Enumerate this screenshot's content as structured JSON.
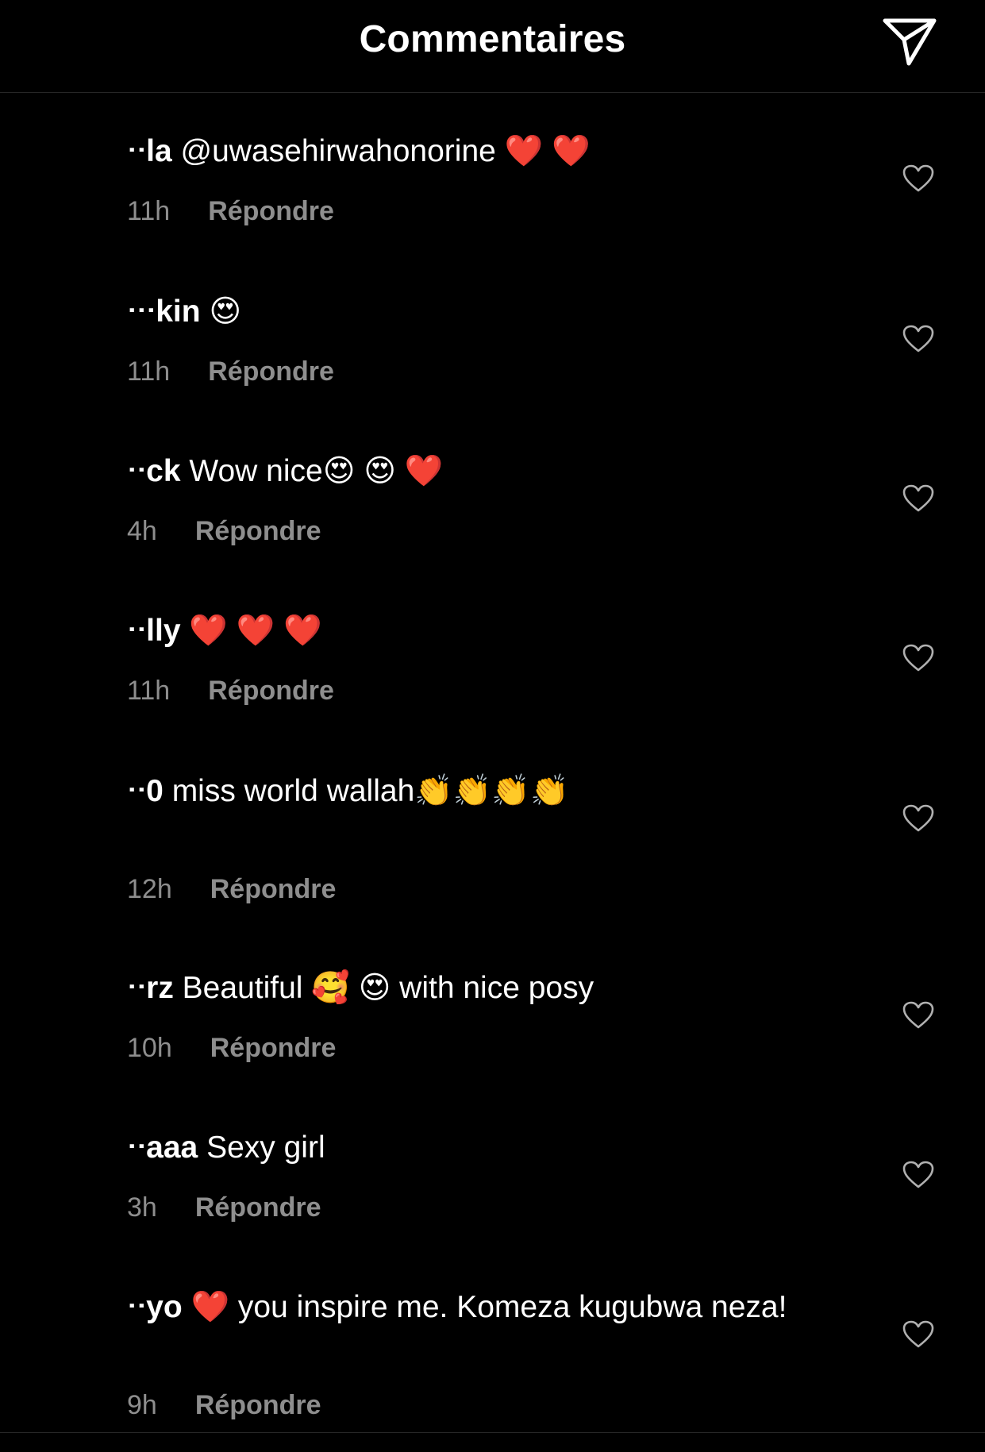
{
  "header": {
    "title": "Commentaires"
  },
  "colors": {
    "background": "#000000",
    "text_primary": "#ffffff",
    "text_secondary": "#8e8e8e",
    "divider": "#262626"
  },
  "comments": [
    {
      "username": "ᐧᐧla",
      "text": "@uwasehirwahonorine ❤️ ❤️",
      "time": "11h",
      "reply_label": "Répondre"
    },
    {
      "username": "ᐧᐧᐧkin",
      "text": "😍",
      "time": "11h",
      "reply_label": "Répondre"
    },
    {
      "username": "ᐧᐧck",
      "text": "Wow nice😍 😍 ❤️",
      "time": "4h",
      "reply_label": "Répondre"
    },
    {
      "username": "ᐧᐧlly",
      "text": "❤️ ❤️ ❤️",
      "time": "11h",
      "reply_label": "Répondre"
    },
    {
      "username": "ᐧᐧ0",
      "text": "miss world wallah👏👏👏👏",
      "time": "12h",
      "reply_label": "Répondre"
    },
    {
      "username": "ᐧᐧrz",
      "text": "Beautiful 🥰 😍  with nice posy",
      "time": "10h",
      "reply_label": "Répondre"
    },
    {
      "username": "ᐧᐧaaa",
      "text": "Sexy girl",
      "time": "3h",
      "reply_label": "Répondre"
    },
    {
      "username": "ᐧᐧyo",
      "text": "❤️  you inspire me. Komeza kugubwa neza!",
      "time": "9h",
      "reply_label": "Répondre"
    }
  ]
}
